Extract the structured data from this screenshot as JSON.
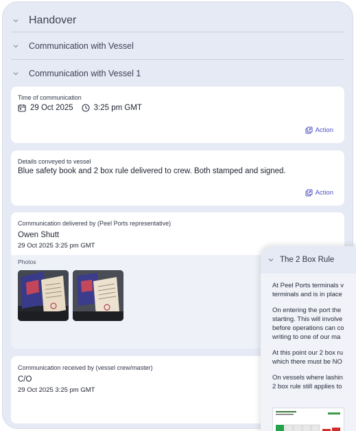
{
  "handover": {
    "title": "Handover"
  },
  "sections": {
    "comm_vessel": "Communication with Vessel",
    "comm_vessel_1": "Communication with Vessel 1"
  },
  "time_card": {
    "label": "Time of communication",
    "date": "29 Oct 2025",
    "time": "3:25 pm GMT",
    "action": "Action"
  },
  "details_card": {
    "label": "Details conveyed to vessel",
    "text": "Blue safety book and 2 box rule delivered to crew. Both stamped and signed.",
    "action": "Action"
  },
  "delivered_card": {
    "label": "Communication delivered by (Peel Ports representative)",
    "name": "Owen Shutt",
    "datetime": "29 Oct 2025 3:25 pm GMT",
    "photos_label": "Photos"
  },
  "received_card": {
    "label": "Communication received by (vessel crew/master)",
    "name": "C/O",
    "datetime": "29 Oct 2025 3:25 pm GMT"
  },
  "overlay": {
    "title": "The 2 Box Rule",
    "lines": [
      "At Peel Ports terminals v",
      "terminals and is in place",
      "On entering the port the",
      "starting. This will involve",
      "before operations can co",
      "writing to one of our ma",
      "At this point our 2 box ru",
      "which there must be NO",
      "On vessels where lashin",
      "2 box rule still applies to"
    ]
  },
  "colors": {
    "panel": "#e6eaf4",
    "card": "#ffffff",
    "accent": "#4a4fc0"
  }
}
